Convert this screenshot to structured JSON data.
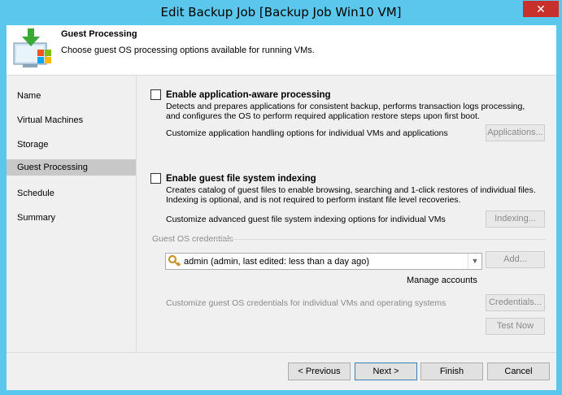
{
  "window": {
    "title": "Edit Backup Job [Backup Job Win10 VM]",
    "close_glyph": "✕"
  },
  "header": {
    "title": "Guest Processing",
    "subtitle": "Choose guest OS processing options available for running VMs."
  },
  "nav": {
    "items": [
      {
        "label": "Name"
      },
      {
        "label": "Virtual Machines"
      },
      {
        "label": "Storage"
      },
      {
        "label": "Guest Processing"
      },
      {
        "label": "Schedule"
      },
      {
        "label": "Summary"
      }
    ],
    "active_index": 3
  },
  "app_aware": {
    "label": "Enable application-aware processing",
    "checked": false,
    "description_line1": "Detects and prepares applications for consistent backup, performs transaction logs processing,",
    "description_line2": "and configures the OS to perform required application restore steps upon first boot.",
    "customize_text": "Customize application handling options for individual VMs and applications",
    "button_label": "Applications..."
  },
  "indexing": {
    "label": "Enable guest file system indexing",
    "checked": false,
    "description_line1": "Creates catalog of guest files to enable browsing, searching and 1-click restores of individual files.",
    "description_line2": "Indexing is optional, and is not required to perform instant file level recoveries.",
    "customize_text": "Customize advanced guest file system indexing options for individual VMs",
    "button_label": "Indexing..."
  },
  "credentials": {
    "group_label": "Guest OS credentials",
    "selected": "admin (admin, last edited: less than a day ago)",
    "add_button": "Add...",
    "manage_link": "Manage accounts",
    "customize_text": "Customize guest OS credentials for individual VMs and operating systems",
    "credentials_button": "Credentials...",
    "test_button": "Test Now"
  },
  "footer": {
    "previous": "< Previous",
    "next": "Next >",
    "finish": "Finish",
    "cancel": "Cancel"
  },
  "colors": {
    "title_bar": "#5cc7ec",
    "close_button": "#c7302b",
    "active_nav": "#c8c8c8"
  }
}
